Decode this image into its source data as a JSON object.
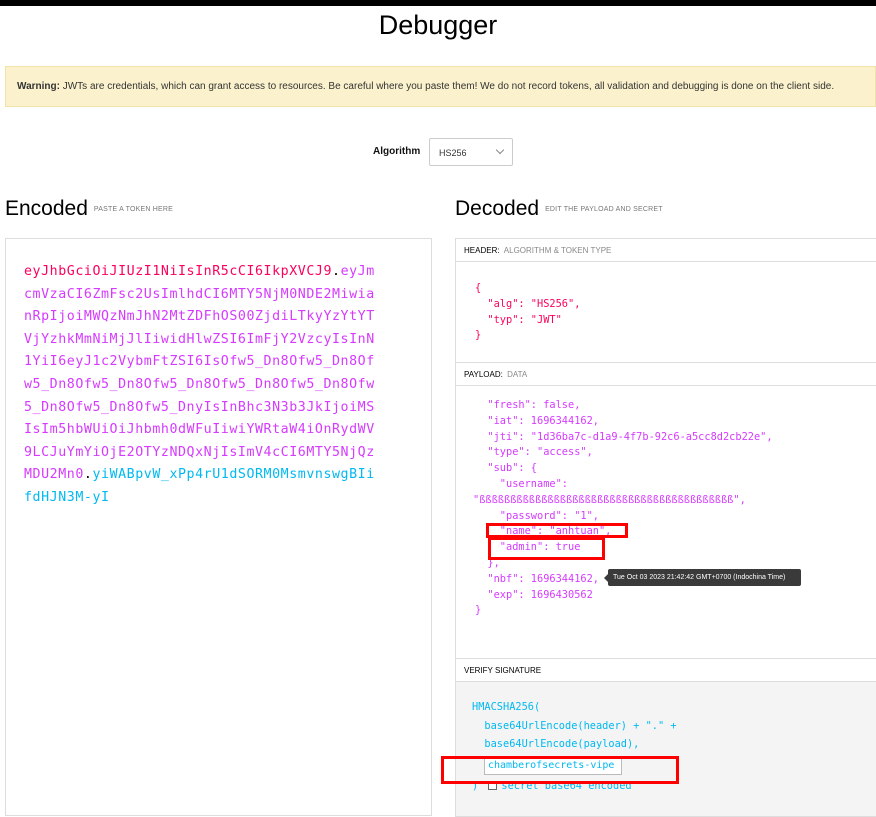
{
  "page": {
    "title": "Debugger",
    "warning_bold": "Warning:",
    "warning_text": " JWTs are credentials, which can grant access to resources. Be careful where you paste them! We do not record tokens, all validation and debugging is done on the client side."
  },
  "algorithm": {
    "label": "Algorithm",
    "selected": "HS256"
  },
  "encoded": {
    "heading": "Encoded",
    "subheading": "PASTE A TOKEN HERE",
    "header_part": "eyJhbGciOiJIUzI1NiIsInR5cCI6IkpXVCJ9",
    "payload_part": "eyJmcmVzaCI6ZmFsc2UsImlhdCI6MTY5NjM0NDE2MiwianRpIjoiMWQzNmJhN2MtZDFhOS00ZjdiLTkyYzYtYTVjYzhkMmNiMjJlIiwidHlwZSI6ImFjY2VzcyIsInN1YiI6eyJ1c2VybmFtZSI6IsOfw5_Dn8Ofw5_Dn8Ofw5_Dn8Ofw5_Dn8Ofw5_Dn8Ofw5_Dn8Ofw5_Dn8Ofw5_Dn8Ofw5_Dn8Ofw5_DnyIsInBhc3N3b3JkIjoiMSIsIm5hbWUiOiJhbmh0dWFuIiwiYWRtaW4iOnRydWV9LCJuYmYiOjE2OTYzNDQxNjIsImV4cCI6MTY5NjQzMDU2Mn0",
    "signature_part": "yiWABpvW_xPp4rU1dSORM0MsmvnswgBIifdHJN3M-yI",
    "dot": "."
  },
  "decoded": {
    "heading": "Decoded",
    "subheading": "EDIT THE PAYLOAD AND SECRET",
    "header_section": {
      "title": "HEADER:",
      "desc": "ALGORITHM & TOKEN TYPE",
      "lines": [
        "{",
        "  \"alg\": \"HS256\",",
        "  \"typ\": \"JWT\"",
        "}"
      ]
    },
    "payload_section": {
      "title": "PAYLOAD:",
      "desc": "DATA",
      "lines": [
        "  \"fresh\": false,",
        "  \"iat\": 1696344162,",
        "  \"jti\": \"1d36ba7c-d1a9-4f7b-92c6-a5cc8d2cb22e\",",
        "  \"type\": \"access\",",
        "  \"sub\": {",
        "    \"username\":",
        "\"ßßßßßßßßßßßßßßßßßßßßßßßßßßßßßßßßßßßßßßßßß\",",
        "    \"password\": \"1\",",
        "    \"name\": \"anhtuan\",",
        "    \"admin\": true",
        "  },",
        "  \"nbf\": 1696344162,",
        "  \"exp\": 1696430562",
        "}"
      ],
      "tooltip": "Tue Oct 03 2023 21:42:42 GMT+0700 (Indochina Time)"
    },
    "verify_section": {
      "title": "VERIFY SIGNATURE",
      "lines": [
        "HMACSHA256(",
        "  base64UrlEncode(header) + \".\" +",
        "  base64UrlEncode(payload),"
      ],
      "secret_value": "chamberofsecrets-vipe",
      "closing": ") ",
      "checkbox_label": "secret base64 encoded"
    }
  }
}
